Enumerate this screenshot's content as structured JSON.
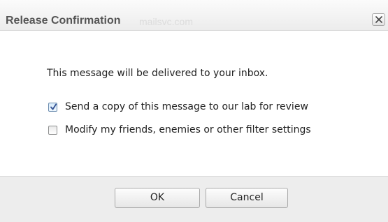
{
  "dialog": {
    "title": "Release Confirmation",
    "background_text": "mailsvc.com",
    "close_icon": "close-icon"
  },
  "body": {
    "message": "This message will be delivered to your inbox.",
    "options": [
      {
        "label": "Send a copy of this message to our lab for review",
        "checked": true
      },
      {
        "label": "Modify my friends, enemies or other filter settings",
        "checked": false
      }
    ]
  },
  "footer": {
    "ok_label": "OK",
    "cancel_label": "Cancel"
  },
  "colors": {
    "title_text": "#555555",
    "footer_bg": "#ededed",
    "check_accent": "#3b5998"
  }
}
